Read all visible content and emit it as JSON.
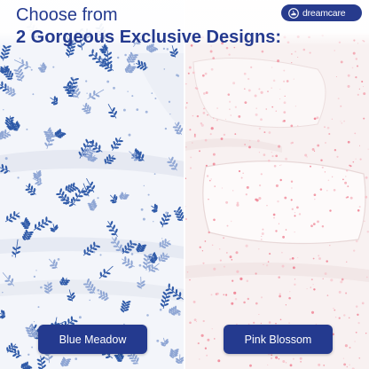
{
  "headline": {
    "line1": "Choose from",
    "line2": "2 Gorgeous Exclusive Designs:"
  },
  "brand": {
    "name": "dreamcare",
    "logo_icon": "moon-cloud-icon"
  },
  "designs": [
    {
      "name": "Blue Meadow",
      "pattern": "blue leaves and sprigs on white"
    },
    {
      "name": "Pink Blossom",
      "pattern": "pink speckled blossoms on white"
    }
  ],
  "colors": {
    "navy": "#243a8f",
    "blue_pattern": "#2f5aa8",
    "blue_pattern_light": "#8fa6d4",
    "pink_pattern": "#f08a9a",
    "pink_pattern_light": "#f6c2ca"
  }
}
